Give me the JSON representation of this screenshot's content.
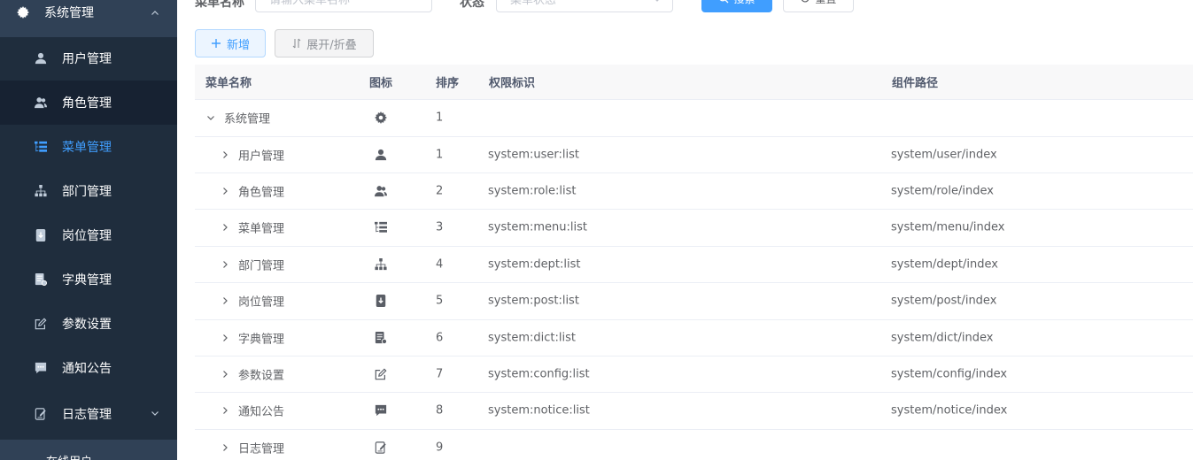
{
  "sidebar": {
    "parent": {
      "label": "系统管理",
      "icon": "gear-icon"
    },
    "items": [
      {
        "label": "用户管理",
        "icon": "user-icon"
      },
      {
        "label": "角色管理",
        "icon": "peoples-icon"
      },
      {
        "label": "菜单管理",
        "icon": "tree-table-icon"
      },
      {
        "label": "部门管理",
        "icon": "tree-icon"
      },
      {
        "label": "岗位管理",
        "icon": "post-icon"
      },
      {
        "label": "字典管理",
        "icon": "dict-icon"
      },
      {
        "label": "参数设置",
        "icon": "edit-icon"
      },
      {
        "label": "通知公告",
        "icon": "message-icon"
      },
      {
        "label": "日志管理",
        "icon": "log-icon"
      }
    ],
    "active_index": 2,
    "next_partial": "在线用户"
  },
  "search": {
    "name_label": "菜单名称",
    "name_placeholder": "请输入菜单名称",
    "status_label": "状态",
    "status_placeholder": "菜单状态",
    "search_label": "搜索",
    "reset_label": "重置"
  },
  "toolbar": {
    "add_label": "新增",
    "expand_label": "展开/折叠"
  },
  "table": {
    "headers": [
      "菜单名称",
      "图标",
      "排序",
      "权限标识",
      "组件路径"
    ],
    "rows": [
      {
        "name": "系统管理",
        "icon": "gear-icon",
        "order": "1",
        "perms": "",
        "component": "",
        "level": 0,
        "expanded": true
      },
      {
        "name": "用户管理",
        "icon": "user-icon",
        "order": "1",
        "perms": "system:user:list",
        "component": "system/user/index",
        "level": 1
      },
      {
        "name": "角色管理",
        "icon": "peoples-icon",
        "order": "2",
        "perms": "system:role:list",
        "component": "system/role/index",
        "level": 1
      },
      {
        "name": "菜单管理",
        "icon": "tree-table-icon",
        "order": "3",
        "perms": "system:menu:list",
        "component": "system/menu/index",
        "level": 1
      },
      {
        "name": "部门管理",
        "icon": "tree-icon",
        "order": "4",
        "perms": "system:dept:list",
        "component": "system/dept/index",
        "level": 1
      },
      {
        "name": "岗位管理",
        "icon": "post-icon",
        "order": "5",
        "perms": "system:post:list",
        "component": "system/post/index",
        "level": 1
      },
      {
        "name": "字典管理",
        "icon": "dict-icon",
        "order": "6",
        "perms": "system:dict:list",
        "component": "system/dict/index",
        "level": 1
      },
      {
        "name": "参数设置",
        "icon": "edit-icon",
        "order": "7",
        "perms": "system:config:list",
        "component": "system/config/index",
        "level": 1
      },
      {
        "name": "通知公告",
        "icon": "message-icon",
        "order": "8",
        "perms": "system:notice:list",
        "component": "system/notice/index",
        "level": 1
      },
      {
        "name": "日志管理",
        "icon": "log-icon",
        "order": "9",
        "perms": "",
        "component": "",
        "level": 1
      }
    ]
  },
  "colors": {
    "sidebar_bg": "#1f2d3d",
    "sidebar_active_text": "#409eff",
    "primary": "#409eff"
  }
}
